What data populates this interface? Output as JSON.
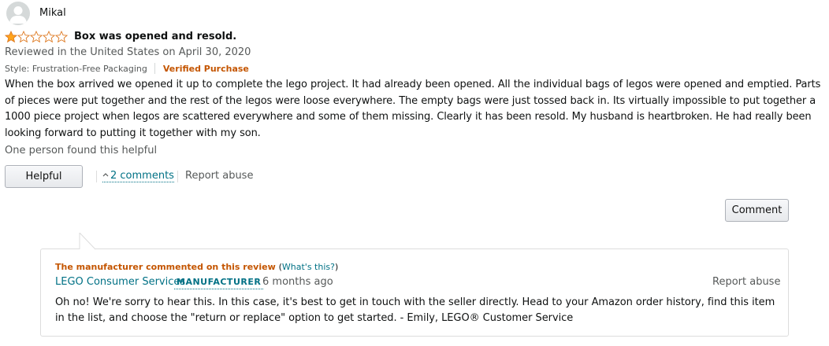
{
  "reviewer": {
    "name": "Mikal"
  },
  "review": {
    "rating": 1,
    "max_rating": 5,
    "title": "Box was opened and resold.",
    "date": "Reviewed in the United States on April 30, 2020",
    "style": "Style: Frustration-Free Packaging",
    "verified": "Verified Purchase",
    "body": "When the box arrived we opened it up to complete the lego project. It had already been opened. All the individual bags of legos were opened and emptied. Parts of pieces were put together and the rest of the legos were loose everywhere. The empty bags were just tossed back in. Its virtually impossible to put together a 1000 piece project when legos are scattered everywhere and some of them missing. Clearly it has been resold. My husband is heartbroken. He had really been looking forward to putting it together with my son.",
    "helpful_count": "One person found this helpful"
  },
  "actions": {
    "helpful_label": "Helpful",
    "comments_label": "2 comments",
    "report_label": "Report abuse",
    "comment_label": "Comment"
  },
  "manufacturer_comment": {
    "heading": "The manufacturer commented on this review",
    "whats_this": "What's this?",
    "paren_open": "(",
    "paren_close": ")",
    "name": "LEGO Consumer Services",
    "badge": "MANUFACTURER",
    "time": "6 months ago",
    "report_label": "Report abuse",
    "body": "Oh no! We're sorry to hear this. In this case, it's best to get in touch with the seller directly. Head to your Amazon order history, find this item in the list, and choose the \"return or replace\" option to get started. - Emily, LEGO® Customer Service"
  },
  "colors": {
    "star": "#ffa41c",
    "link": "#007185",
    "verified": "#c45500",
    "muted": "#565959"
  },
  "icons": {
    "avatar": "user-silhouette-icon",
    "stars": "star-icon",
    "chevron": "chevron-up-icon"
  }
}
